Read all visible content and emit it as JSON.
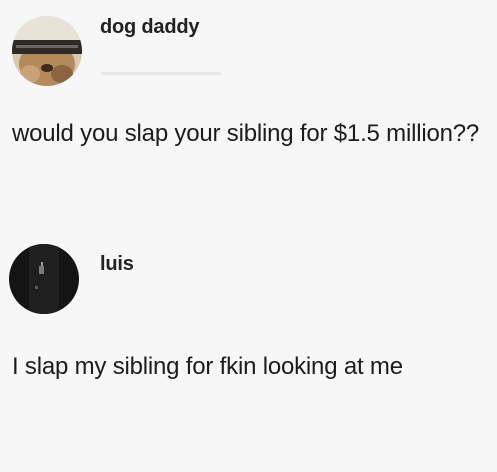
{
  "posts": [
    {
      "author": "dog daddy",
      "avatar": "dog-photo-avatar",
      "text": "would you slap your sibling for $1.5 million??"
    },
    {
      "author": "luis",
      "avatar": "dark-photo-avatar",
      "text": "I slap my sibling for fkin looking at me"
    }
  ],
  "colors": {
    "background": "#f7f7f7",
    "text": "#1c1c1c",
    "username": "#222222"
  }
}
